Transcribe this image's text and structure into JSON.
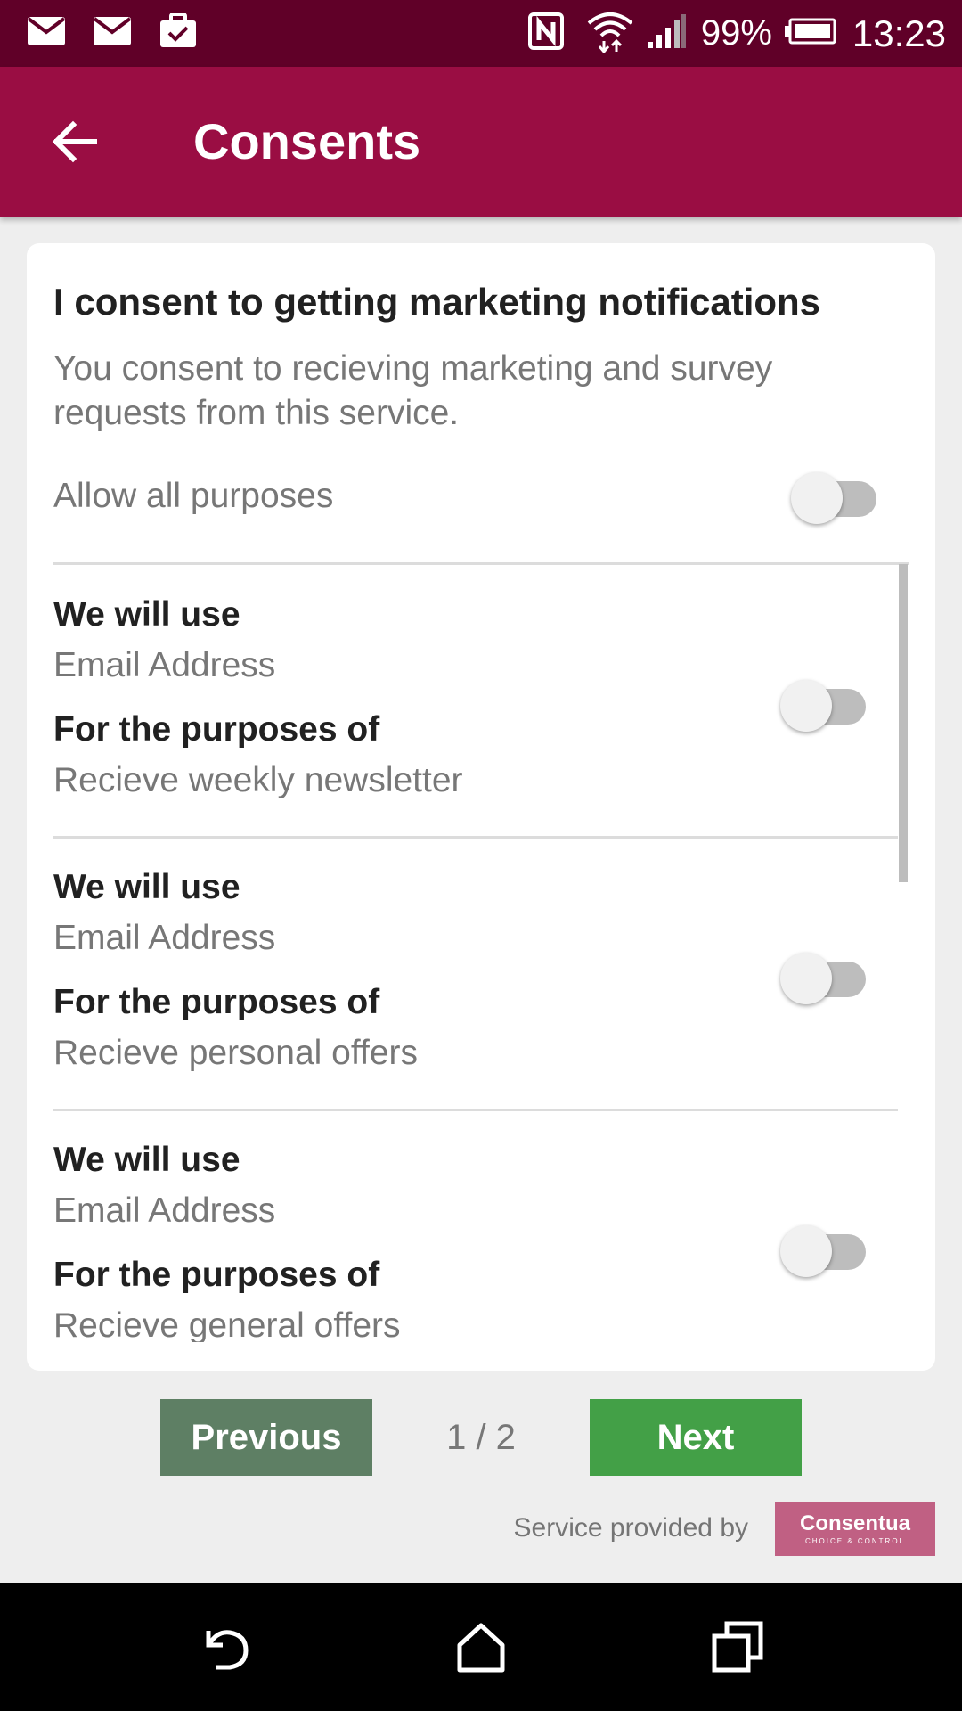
{
  "status_bar": {
    "battery": "99%",
    "time": "13:23",
    "icons": [
      "mail-icon",
      "mail-icon",
      "briefcase-check-icon",
      "nfc-icon",
      "wifi-icon",
      "signal-icon",
      "battery-icon"
    ]
  },
  "app_bar": {
    "title": "Consents",
    "back_icon": "arrow-left-icon"
  },
  "consent": {
    "title": "I consent to getting marketing notifications",
    "description": "You consent to recieving marketing and survey requests from this service.",
    "allow_all_label": "Allow all purposes",
    "allow_all_enabled": false
  },
  "purposes": [
    {
      "use_heading": "We will use",
      "use_value": "Email Address",
      "purpose_heading": "For the purposes of",
      "purpose_value": "Recieve weekly newsletter",
      "enabled": false
    },
    {
      "use_heading": "We will use",
      "use_value": "Email Address",
      "purpose_heading": "For the purposes of",
      "purpose_value": "Recieve personal offers",
      "enabled": false
    },
    {
      "use_heading": "We will use",
      "use_value": "Email Address",
      "purpose_heading": "For the purposes of",
      "purpose_value": "Recieve general offers",
      "enabled": false
    }
  ],
  "pagination": {
    "previous_label": "Previous",
    "next_label": "Next",
    "page_indicator": "1 / 2"
  },
  "footer": {
    "service_text": "Service provided by",
    "brand_name": "Consentua",
    "brand_tagline": "CHOICE & CONTROL"
  },
  "colors": {
    "status_bar": "#600028",
    "app_bar": "#9a0d43",
    "previous_button": "#5e7f64",
    "next_button": "#43a047",
    "brand": "#c06083"
  },
  "nav_bar": {
    "icons": [
      "back-icon",
      "home-icon",
      "recents-icon"
    ]
  }
}
